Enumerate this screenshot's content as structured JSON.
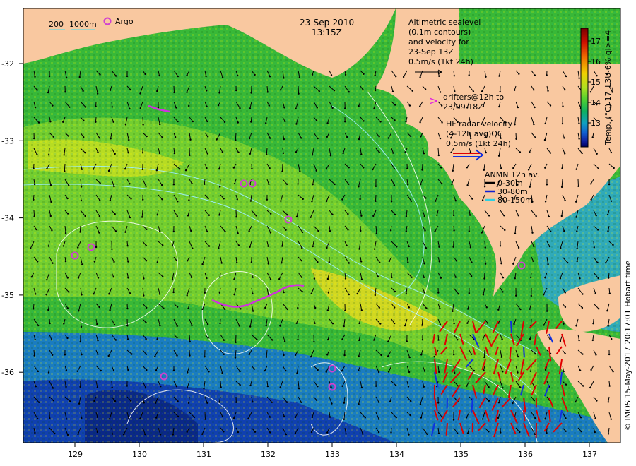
{
  "title": {
    "date": "23-Sep-2010",
    "time": "13:15Z"
  },
  "bathymetry_legend": {
    "labels": [
      "200",
      "1000m"
    ],
    "color": "#7fd8d8"
  },
  "argo_legend": {
    "label": "Argo",
    "color": "#d040d0"
  },
  "altimetry_legend": {
    "lines": [
      "Altimetric sealevel",
      "(0.1m contours)",
      "and velocity for",
      "23-Sep 13Z",
      "0.5m/s (1kt 24h)"
    ]
  },
  "drifters_legend": {
    "lines": [
      "drifters@12h to",
      "23/09 18Z"
    ],
    "color": "#e020e0"
  },
  "hf_radar_legend": {
    "lines": [
      "HF radar velocity",
      "(4-12h avg)QC",
      "0.5m/s (1kt 24h)"
    ],
    "colors": [
      "#e00000",
      "#1030e0"
    ]
  },
  "anmn_legend": {
    "title": "ANMN 12h av.",
    "items": [
      {
        "label": "0-30m",
        "color": "#000000"
      },
      {
        "label": "30-80m",
        "color": "#1020d0"
      },
      {
        "label": "80-150m",
        "color": "#30d0e0"
      }
    ]
  },
  "colorbar": {
    "ticks": [
      "17",
      "16",
      "15",
      "14",
      "13"
    ],
    "title": "Temp. (°C) 17_L3U 6% ql>=4",
    "colors": [
      "#7a0000",
      "#d01000",
      "#f07000",
      "#f0d000",
      "#b0e020",
      "#50d030",
      "#10b060",
      "#10a0c0",
      "#1060d0",
      "#1020a0",
      "#000060"
    ]
  },
  "axes": {
    "x_ticks": [
      "129",
      "130",
      "131",
      "132",
      "133",
      "134",
      "135",
      "136",
      "137"
    ],
    "y_ticks": [
      "-32",
      "-33",
      "-34",
      "-35",
      "-36"
    ]
  },
  "credit": "© IMOS 15-May-2017 20:17:01 Hobart time",
  "colors": {
    "land": "#f9c8a0",
    "sea_warm": "#40c040",
    "sea_cold": "#1040b0",
    "frame": "#000000"
  }
}
